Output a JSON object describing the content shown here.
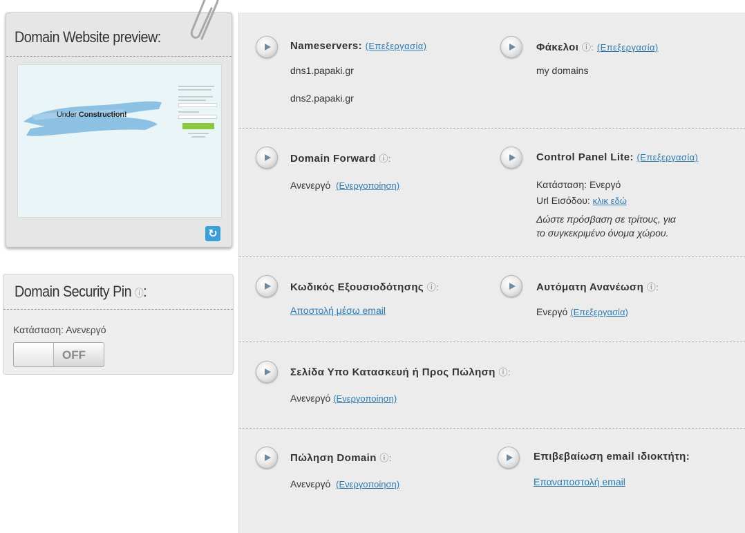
{
  "preview_card": {
    "title": "Domain Website preview:",
    "under_prefix": "Under ",
    "under_bold": "Construction!"
  },
  "security_pin": {
    "title": "Domain Security Pin",
    "info_glyph": "ⓘ",
    "title_suffix": ":",
    "status": "Κατάσταση: Ανενεργό",
    "toggle_label": "OFF"
  },
  "sections": {
    "nameservers": {
      "label": "Nameservers:",
      "edit": "(Επεξεργασία)",
      "values": [
        "dns1.papaki.gr",
        "dns2.papaki.gr"
      ]
    },
    "folders": {
      "label": "Φάκελοι",
      "info": "ⓘ:",
      "edit": "(Επεξεργασία)",
      "value": "my domains"
    },
    "domain_forward": {
      "label": "Domain Forward",
      "info": "ⓘ:",
      "value": "Ανενεργό",
      "action": "(Ενεργοποίηση)"
    },
    "control_panel": {
      "label": "Control Panel Lite:",
      "edit": "(Επεξεργασία)",
      "status": "Κατάσταση: Ενεργό",
      "url_label": "Url Εισόδου:",
      "url_link": "κλικ εδώ",
      "note_line1": "Δώστε πρόσβαση σε τρίτους, για",
      "note_line2": "το συγκεκριμένο όνομα χώρου."
    },
    "auth_code": {
      "label": "Κωδικός Εξουσιοδότησης",
      "info": "ⓘ:",
      "action": "Αποστολή μέσω email"
    },
    "auto_renew": {
      "label": "Αυτόματη Ανανέωση",
      "info": "ⓘ:",
      "value": "Ενεργό",
      "edit": "(Επεξεργασία)"
    },
    "construction_page": {
      "label": "Σελίδα Υπο Κατασκευή ή Προς Πώληση",
      "info": "ⓘ:",
      "value": "Ανενεργό",
      "action": "(Ενεργοποίηση)"
    },
    "domain_sale": {
      "label": "Πώληση Domain",
      "info": "ⓘ:",
      "value": "Ανενεργό",
      "action": "(Ενεργοποίηση)"
    },
    "owner_email": {
      "label": "Επιβεβαίωση email ιδιοκτήτη:",
      "action": "Επαναποστολή email"
    }
  },
  "colors": {
    "link": "#2a7ab0",
    "panel_bg": "#ececec",
    "refresh_button": "#3b9fd8",
    "mini_button": "#8dc63f"
  },
  "icons": {
    "section_arrow": "play-arrow-icon",
    "refresh": "refresh-icon",
    "attachment": "paperclip-icon"
  }
}
